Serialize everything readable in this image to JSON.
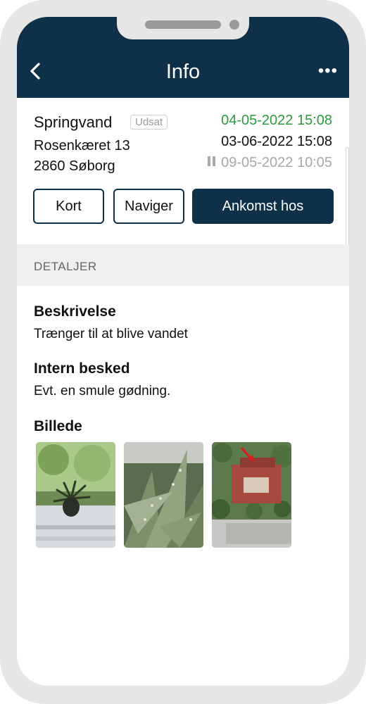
{
  "header": {
    "title": "Info"
  },
  "item": {
    "name": "Springvand",
    "badge": "Udsat",
    "address_line1": "Rosenkæret 13",
    "address_line2": "2860 Søborg",
    "date_green": "04-05-2022 15:08",
    "date_black": "03-06-2022 15:08",
    "date_paused": "09-05-2022 10:05"
  },
  "buttons": {
    "kort": "Kort",
    "naviger": "Naviger",
    "ankomst": "Ankomst hos"
  },
  "section": {
    "title": "DETALJER"
  },
  "details": {
    "description_label": "Beskrivelse",
    "description_text": "Trænger til at blive vandet",
    "message_label": "Intern besked",
    "message_text": "Evt. en smule gødning.",
    "images_label": "Billede"
  },
  "colors": {
    "header": "#0e3048",
    "green_date": "#2e9a3c",
    "paused_date": "#a8a8a8"
  }
}
